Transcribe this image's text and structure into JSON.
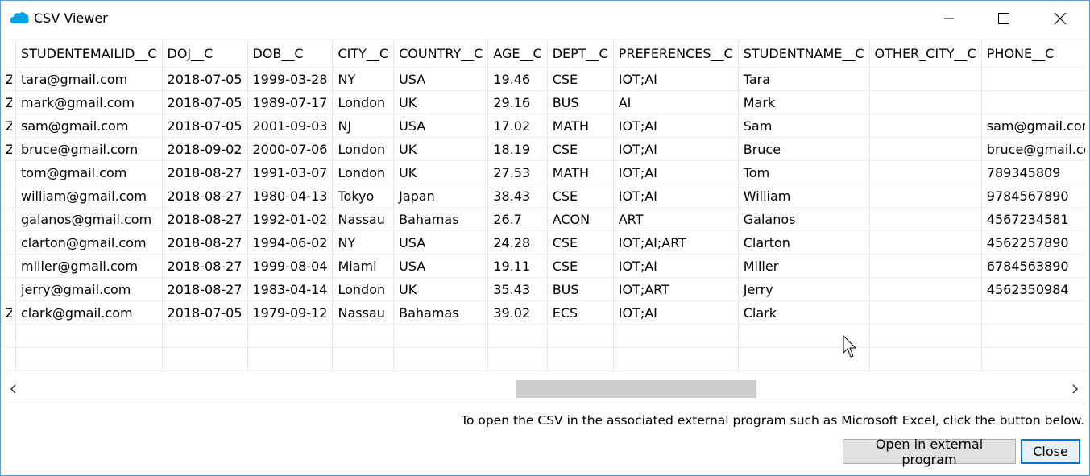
{
  "window": {
    "title": "CSV Viewer",
    "controls": [
      "minimize",
      "maximize",
      "close"
    ]
  },
  "grid": {
    "columns": [
      "",
      "STUDENTEMAILID__C",
      "DOJ__C",
      "DOB__C",
      "CITY__C",
      "COUNTRY__C",
      "AGE__C",
      "DEPT__C",
      "PREFERENCES__C",
      "STUDENTNAME__C",
      "OTHER_CITY__C",
      "PHONE__C"
    ],
    "rows": [
      [
        "Z",
        "tara@gmail.com",
        "2018-07-05",
        "1999-03-28",
        "NY",
        "USA",
        "19.46",
        "CSE",
        "IOT;AI",
        "Tara",
        "",
        ""
      ],
      [
        "Z",
        "mark@gmail.com",
        "2018-07-05",
        "1989-07-17",
        "London",
        "UK",
        "29.16",
        "BUS",
        "AI",
        "Mark",
        "",
        ""
      ],
      [
        "Z",
        "sam@gmail.com",
        "2018-07-05",
        "2001-09-03",
        "NJ",
        "USA",
        "17.02",
        "MATH",
        "IOT;AI",
        "Sam",
        "",
        "sam@gmail.cor"
      ],
      [
        "Z",
        "bruce@gmail.com",
        "2018-09-02",
        "2000-07-06",
        "London",
        "UK",
        "18.19",
        "CSE",
        "IOT;AI",
        "Bruce",
        "",
        "bruce@gmail.cc"
      ],
      [
        "",
        "tom@gmail.com",
        "2018-08-27",
        "1991-03-07",
        "London",
        "UK",
        "27.53",
        "MATH",
        "IOT;AI",
        "Tom",
        "",
        "789345809"
      ],
      [
        "",
        "william@gmail.com",
        "2018-08-27",
        "1980-04-13",
        "Tokyo",
        "Japan",
        "38.43",
        "CSE",
        "IOT;AI",
        "William",
        "",
        "9784567890"
      ],
      [
        "",
        "galanos@gmail.com",
        "2018-08-27",
        "1992-01-02",
        "Nassau",
        "Bahamas",
        "26.7",
        "ACON",
        "ART",
        "Galanos",
        "",
        "4567234581"
      ],
      [
        "",
        "clarton@gmail.com",
        "2018-08-27",
        "1994-06-02",
        "NY",
        "USA",
        "24.28",
        "CSE",
        "IOT;AI;ART",
        "Clarton",
        "",
        "4562257890"
      ],
      [
        "",
        "miller@gmail.com",
        "2018-08-27",
        "1999-08-04",
        "Miami",
        "USA",
        "19.11",
        "CSE",
        "IOT;AI",
        "Miller",
        "",
        "6784563890"
      ],
      [
        "",
        "jerry@gmail.com",
        "2018-08-27",
        "1983-04-14",
        "London",
        "UK",
        "35.43",
        "BUS",
        "IOT;ART",
        "Jerry",
        "",
        "4562350984"
      ],
      [
        "Z",
        "clark@gmail.com",
        "2018-07-05",
        "1979-09-12",
        "Nassau",
        "Bahamas",
        "39.02",
        "ECS",
        "IOT;AI",
        "Clark",
        "",
        ""
      ]
    ],
    "empty_rows": 2
  },
  "footer": {
    "info": "To open the CSV in the associated external program such as Microsoft Excel, click the button below.",
    "open_button": "Open in external program",
    "close_button": "Close"
  },
  "colors": {
    "accent": "#0078d7",
    "app_icon": "#00a1e0",
    "scroll_thumb": "#cdcdcd"
  }
}
